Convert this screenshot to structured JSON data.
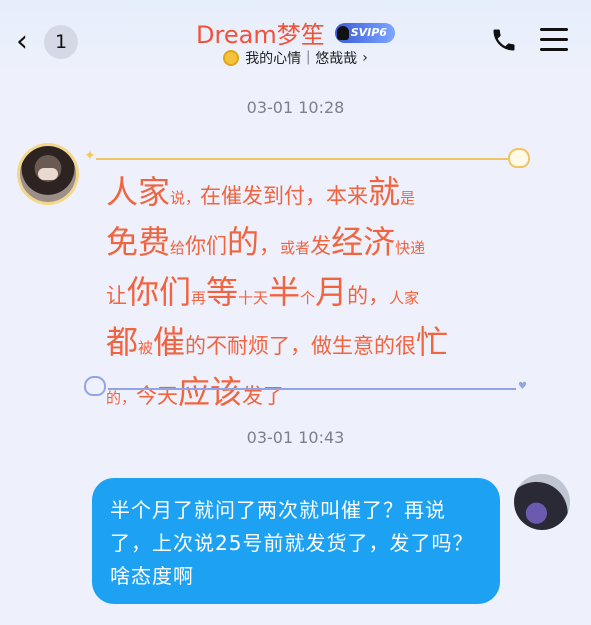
{
  "header": {
    "back_count": "1",
    "title": "Dream梦笙",
    "badge": "SVIP6",
    "subtitle": "我的心情｜悠哉哉",
    "title_color": "#f0523a",
    "icons": [
      "back-chevron-icon",
      "mood-icon",
      "phone-icon",
      "menu-icon"
    ]
  },
  "messages": [
    {
      "timestamp": "03-01 10:28",
      "side": "left",
      "style": "fancy-text",
      "text_color": "#f0643f",
      "text": "人家说，在催发到付，本来就是免费给你们的，或者发经济快递让你们再等十天半个月的，人家都被催的不耐烦了，做生意的很忙的，今天应该发了"
    },
    {
      "timestamp": "03-01 10:43",
      "side": "right",
      "bubble_color": "#1da1f2",
      "text": "半个月了就问了两次就叫催了？再说了，上次说25号前就发货了，发了吗？啥态度啊"
    }
  ]
}
